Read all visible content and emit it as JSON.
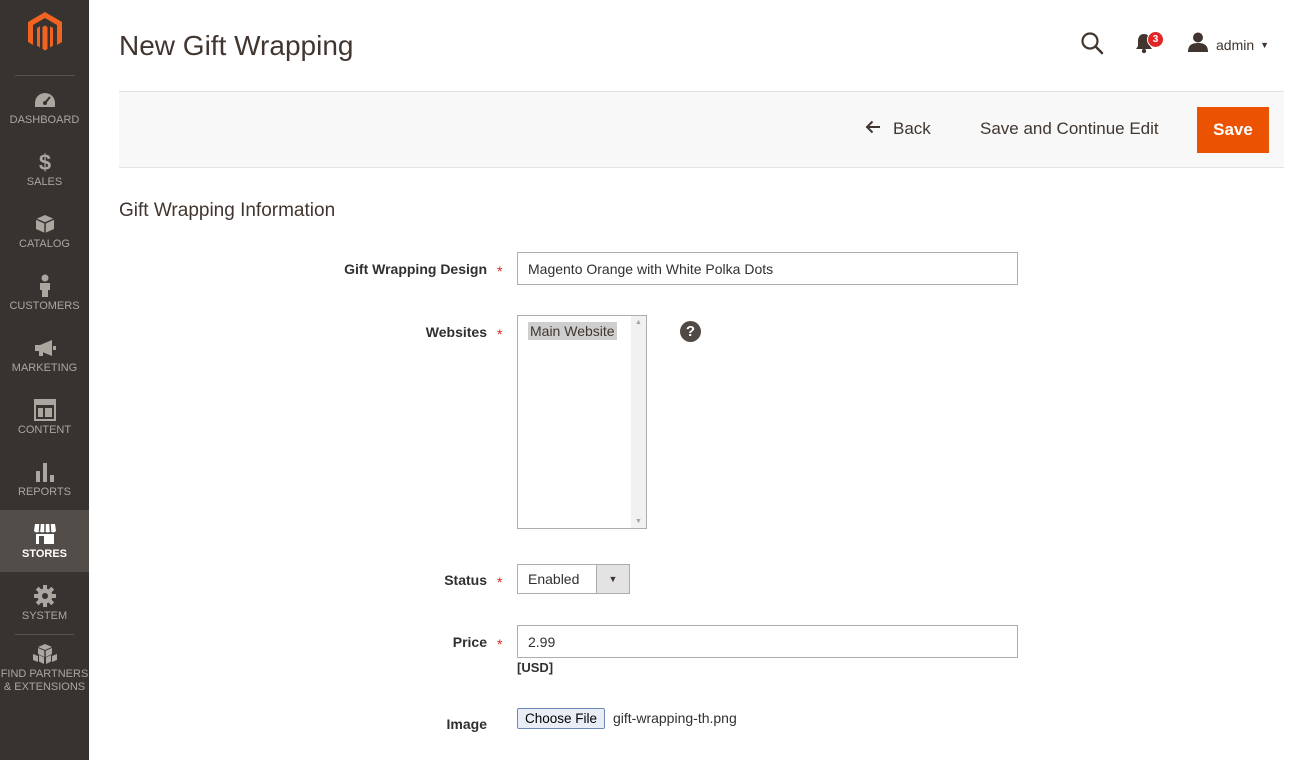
{
  "page": {
    "title": "New Gift Wrapping"
  },
  "header": {
    "notification_count": "3",
    "user": "admin"
  },
  "sidebar": {
    "items": [
      {
        "label": "DASHBOARD",
        "icon": "dashboard-icon"
      },
      {
        "label": "SALES",
        "icon": "dollar-icon"
      },
      {
        "label": "CATALOG",
        "icon": "box-icon"
      },
      {
        "label": "CUSTOMERS",
        "icon": "person-icon"
      },
      {
        "label": "MARKETING",
        "icon": "megaphone-icon"
      },
      {
        "label": "CONTENT",
        "icon": "layout-icon"
      },
      {
        "label": "REPORTS",
        "icon": "bar-chart-icon"
      },
      {
        "label": "STORES",
        "icon": "storefront-icon"
      },
      {
        "label": "SYSTEM",
        "icon": "gear-icon"
      },
      {
        "label": "FIND PARTNERS & EXTENSIONS",
        "icon": "cubes-icon"
      }
    ],
    "active": "STORES"
  },
  "actions": {
    "back": "Back",
    "save_continue": "Save and Continue Edit",
    "save": "Save"
  },
  "section": {
    "title": "Gift Wrapping Information"
  },
  "form": {
    "design": {
      "label": "Gift Wrapping Design",
      "value": "Magento Orange with White Polka Dots"
    },
    "websites": {
      "label": "Websites",
      "options": [
        "Main Website"
      ]
    },
    "status": {
      "label": "Status",
      "value": "Enabled"
    },
    "price": {
      "label": "Price",
      "value": "2.99",
      "currency": "[USD]"
    },
    "image": {
      "label": "Image",
      "button": "Choose File",
      "filename": "gift-wrapping-th.png"
    }
  },
  "colors": {
    "sidebar": "#373330",
    "accent": "#eb5202",
    "required": "#e22626"
  }
}
